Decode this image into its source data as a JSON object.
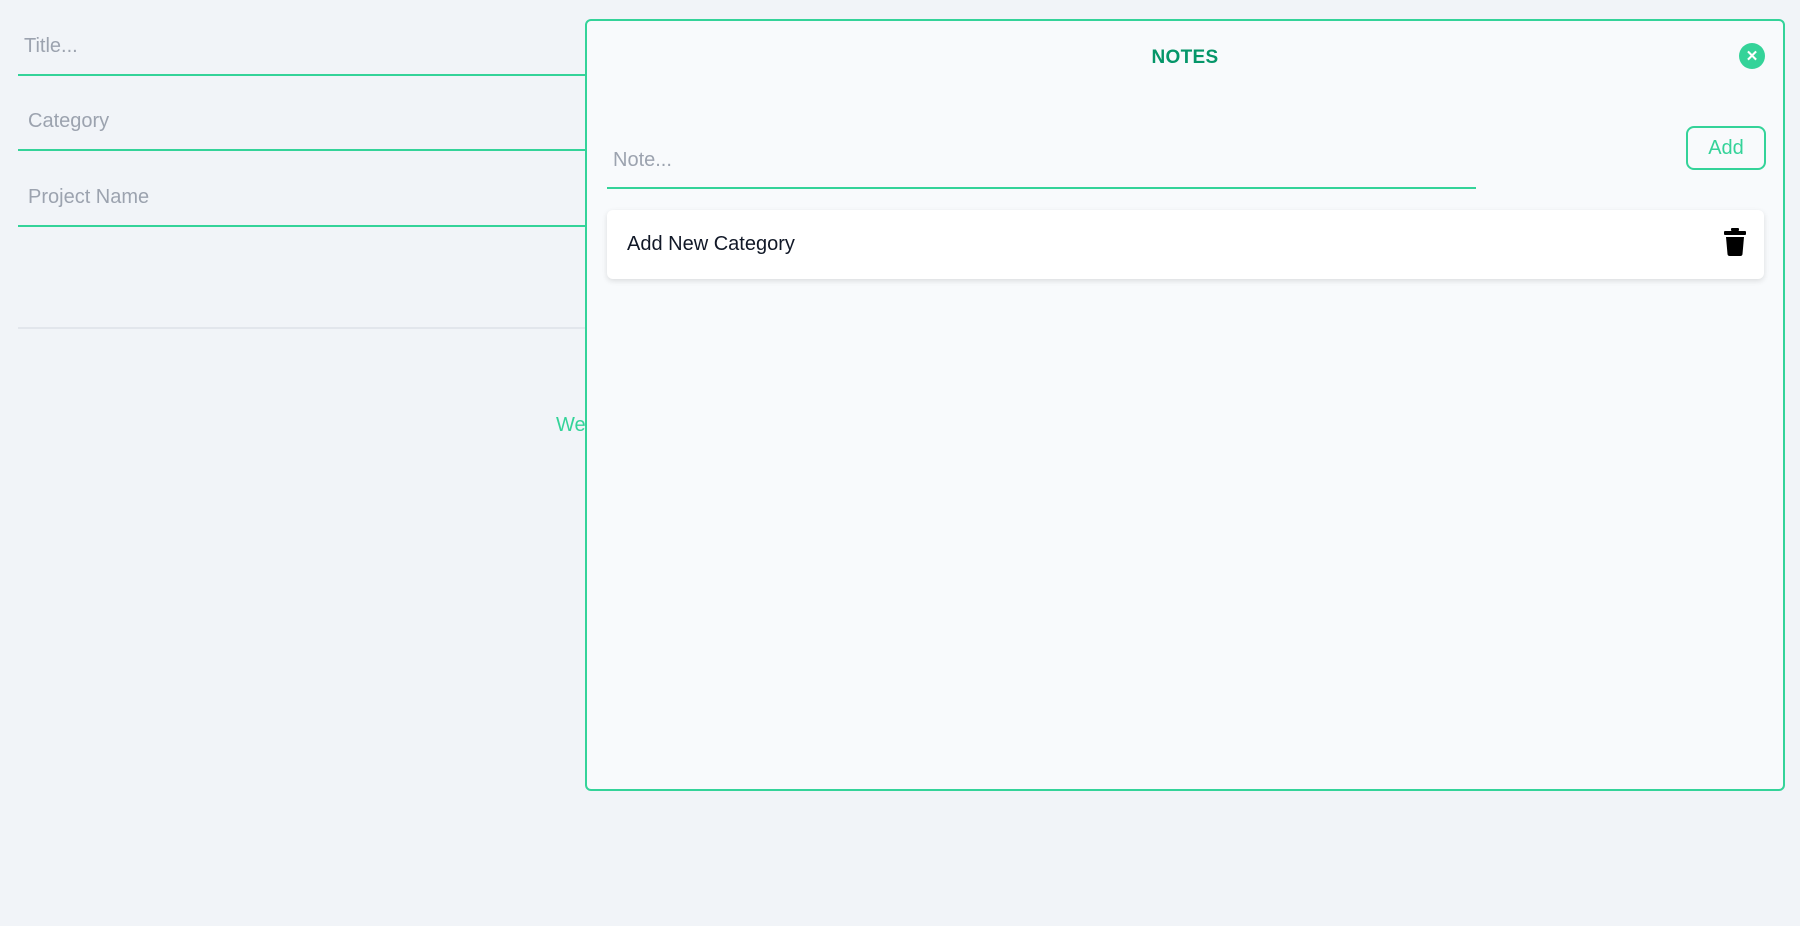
{
  "background_form": {
    "title_placeholder": "Title...",
    "category_placeholder": "Category",
    "project_placeholder": "Project Name",
    "partial_text": "We"
  },
  "notes_modal": {
    "title": "NOTES",
    "close_icon": "close-icon",
    "note_input_placeholder": "Note...",
    "add_label": "Add",
    "items": [
      {
        "text": "Add New Category",
        "delete_icon": "trash-icon"
      }
    ]
  },
  "colors": {
    "accent": "#34d399",
    "title": "#059669",
    "background": "#f1f4f8",
    "modal_background": "#f8fafc"
  }
}
